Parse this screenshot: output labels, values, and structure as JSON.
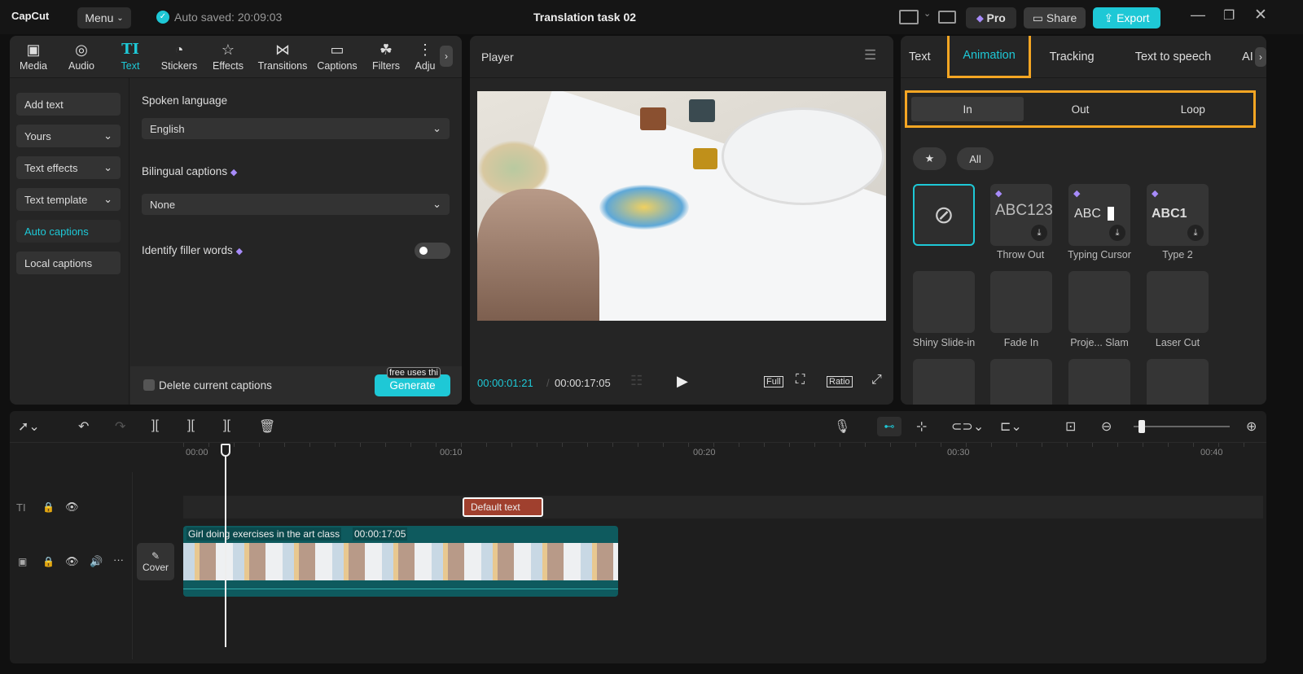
{
  "app": {
    "logo": "CapCut",
    "menu": "Menu",
    "autosave": "Auto saved: 20:09:03",
    "title": "Translation task 02",
    "pro": "Pro",
    "share": "Share",
    "export": "Export"
  },
  "left_tabs": [
    {
      "label": "Media",
      "icon": "▣"
    },
    {
      "label": "Audio",
      "icon": "◎"
    },
    {
      "label": "Text",
      "icon": "TI"
    },
    {
      "label": "Stickers",
      "icon": "◔"
    },
    {
      "label": "Effects",
      "icon": "☆"
    },
    {
      "label": "Transitions",
      "icon": "⋈"
    },
    {
      "label": "Captions",
      "icon": "▭"
    },
    {
      "label": "Filters",
      "icon": "☘"
    },
    {
      "label": "Adju",
      "icon": "⋮"
    }
  ],
  "side": [
    "Add text",
    "Yours",
    "Text effects",
    "Text template",
    "Auto captions",
    "Local captions"
  ],
  "captions": {
    "spoken_label": "Spoken language",
    "spoken_value": "English",
    "bilingual_label": "Bilingual captions",
    "bilingual_value": "None",
    "filler_label": "Identify filler words",
    "filler_on": false,
    "delete_label": "Delete current captions",
    "generate": "Generate",
    "free_tip": "free uses thi"
  },
  "player": {
    "title": "Player",
    "current": "00:00:01:21",
    "total": "00:00:17:05",
    "full": "Full",
    "ratio": "Ratio"
  },
  "right_tabs": [
    "Text",
    "Animation",
    "Tracking",
    "Text to speech",
    "AI"
  ],
  "anim": {
    "subtabs": [
      "In",
      "Out",
      "Loop"
    ],
    "filter_all": "All",
    "items": [
      {
        "name": "",
        "preview": ""
      },
      {
        "name": "Throw Out",
        "preview": "ABC123"
      },
      {
        "name": "Typing Cursor",
        "preview": "ABC"
      },
      {
        "name": "Type 2",
        "preview": "ABC1"
      },
      {
        "name": "Shiny Slide-in",
        "preview": ""
      },
      {
        "name": "Fade In",
        "preview": ""
      },
      {
        "name": "Proje... Slam",
        "preview": ""
      },
      {
        "name": "Laser Cut",
        "preview": ""
      }
    ]
  },
  "timeline": {
    "ruler": [
      "00:00",
      "00:10",
      "00:20",
      "00:30",
      "00:40"
    ],
    "text_clip": "Default text",
    "video_clip": "Girl doing exercises in the art class",
    "video_duration": "00:00:17:05",
    "cover": "Cover"
  },
  "colors": {
    "accent": "#1ec8d6",
    "highlight": "#f5a623",
    "text_clip": "#a0402e",
    "video_clip": "#0e5a5e"
  }
}
